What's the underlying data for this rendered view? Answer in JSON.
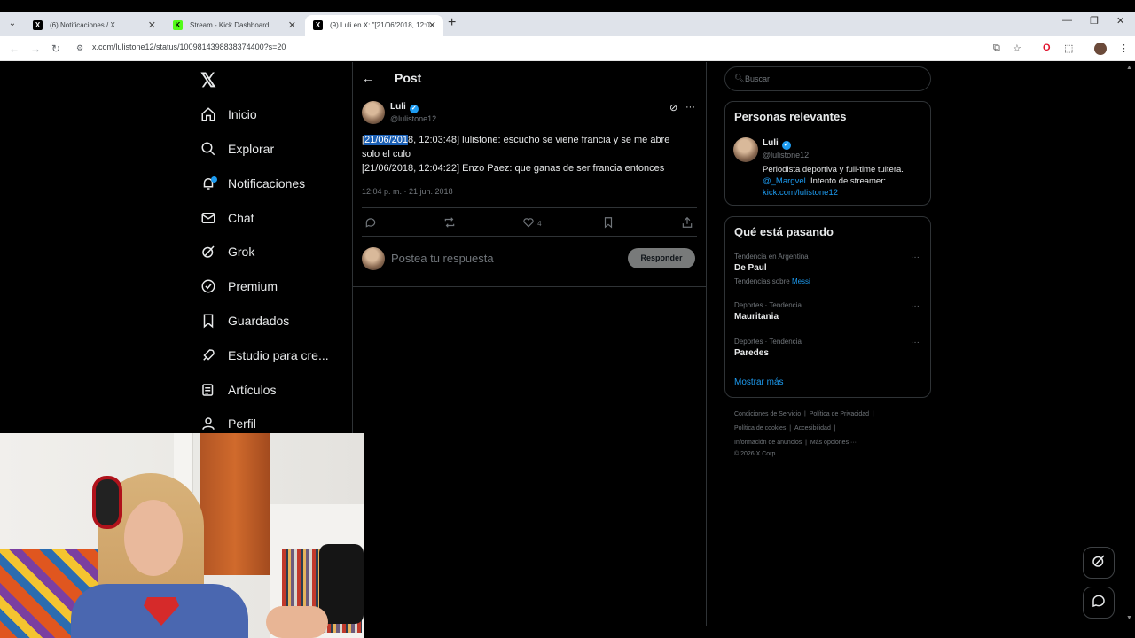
{
  "browser": {
    "tabs": [
      {
        "title": "(6) Notificaciones / X",
        "favicon": "x-favicon"
      },
      {
        "title": "Stream - Kick Dashboard",
        "favicon": "kick-favicon"
      },
      {
        "title": "(9) Luli en X: \"[21/06/2018, 12:0",
        "favicon": "x-favicon"
      }
    ],
    "url": "x.com/lulistone12/status/1009814398838374400?s=20",
    "colors": {
      "tab_strip": "#dfe3ea",
      "active_tab": "#ffffff"
    }
  },
  "nav": {
    "items": [
      {
        "label": "Inicio",
        "icon": "home-icon"
      },
      {
        "label": "Explorar",
        "icon": "search-icon"
      },
      {
        "label": "Notificaciones",
        "icon": "bell-icon"
      },
      {
        "label": "Chat",
        "icon": "mail-icon"
      },
      {
        "label": "Grok",
        "icon": "grok-icon"
      },
      {
        "label": "Premium",
        "icon": "verified-badge-icon"
      },
      {
        "label": "Guardados",
        "icon": "bookmark-icon"
      },
      {
        "label": "Estudio para cre...",
        "icon": "rocket-icon"
      },
      {
        "label": "Artículos",
        "icon": "article-icon"
      },
      {
        "label": "Perfil",
        "icon": "person-icon"
      }
    ]
  },
  "post": {
    "header_title": "Post",
    "author": {
      "name": "Luli",
      "handle": "@lulistone12"
    },
    "lines": {
      "l1_pre": "[",
      "l1_sel": "21/06/201",
      "l1_post": "8, 12:03:48] lulistone: escucho se viene francia y se me abre",
      "l2": "solo el culo",
      "l3": "[21/06/2018, 12:04:22] Enzo Paez: que ganas de ser francia entonces"
    },
    "timestamp": "12:04 p. m. · 21 jun. 2018",
    "likes": "4",
    "reply_placeholder": "Postea tu respuesta",
    "reply_button": "Responder"
  },
  "sidebar": {
    "search_placeholder": "Buscar",
    "relevant": {
      "title": "Personas relevantes",
      "name": "Luli",
      "handle": "@lulistone12",
      "bio1": "Periodista deportiva y full-time tuitera.",
      "bio2_link": "@_Margvel",
      "bio2_text": ". Intento de streamer:",
      "bio3_link": "kick.com/lulistone12"
    },
    "trending": {
      "title": "Qué está pasando",
      "items": [
        {
          "meta": "Tendencia en Argentina",
          "name": "De Paul",
          "extra_prefix": "Tendencias sobre ",
          "extra_link": "Messi"
        },
        {
          "meta": "Deportes · Tendencia",
          "name": "Mauritania"
        },
        {
          "meta": "Deportes · Tendencia",
          "name": "Paredes"
        }
      ],
      "show_more": "Mostrar más"
    },
    "footer": {
      "row1": [
        "Condiciones de Servicio",
        "Política de Privacidad"
      ],
      "row2": [
        "Política de cookies",
        "Accesibilidad"
      ],
      "row3": [
        "Información de anuncios",
        "Más opciones ···"
      ],
      "copyright": "© 2026 X Corp."
    }
  },
  "colors": {
    "accent": "#1d9bf0",
    "background": "#000000",
    "border": "#2f3336",
    "muted": "#71767b"
  }
}
